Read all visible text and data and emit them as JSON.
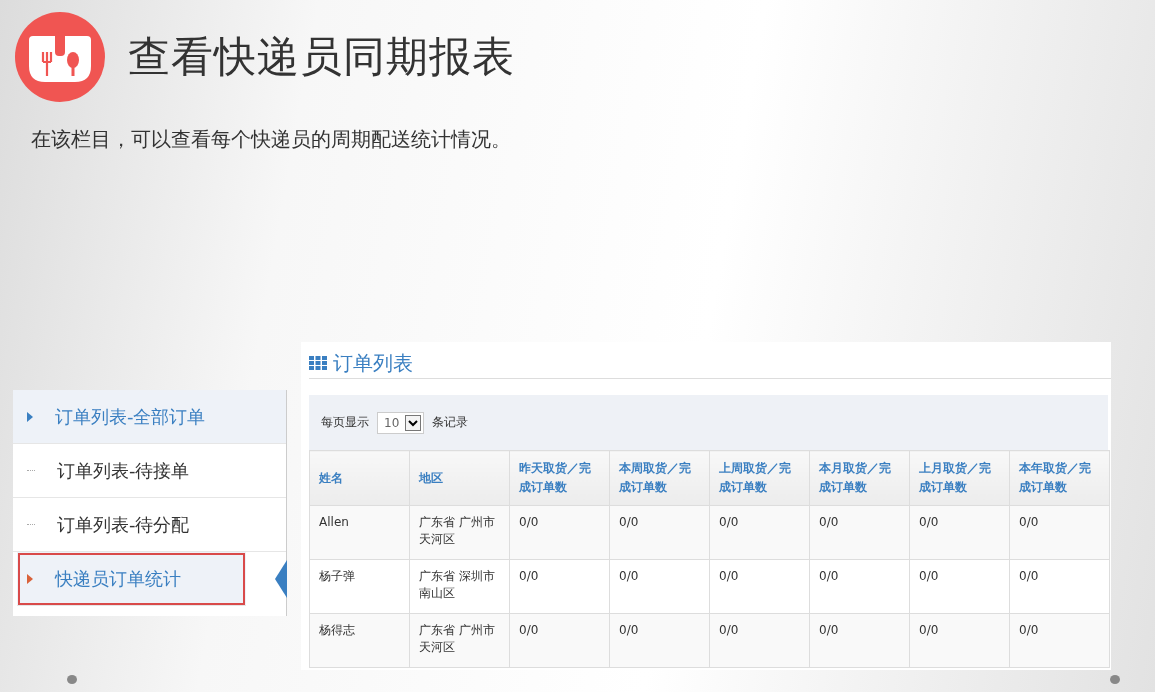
{
  "title": "查看快递员同期报表",
  "subtitle": "在该栏目，可以查看每个快递员的周期配送统计情况。",
  "sidebar": {
    "items": [
      {
        "label": "订单列表-全部订单",
        "kind": "parent",
        "selected": false
      },
      {
        "label": "订单列表-待接单",
        "kind": "child",
        "selected": false
      },
      {
        "label": "订单列表-待分配",
        "kind": "child",
        "selected": false
      },
      {
        "label": "快递员订单统计",
        "kind": "parent",
        "selected": true
      }
    ]
  },
  "panel": {
    "title": "订单列表",
    "page_size": {
      "before": "每页显示",
      "value": "10",
      "after": "条记录"
    },
    "table": {
      "columns": [
        "姓名",
        "地区",
        "昨天取货／完成订单数",
        "本周取货／完成订单数",
        "上周取货／完成订单数",
        "本月取货／完成订单数",
        "上月取货／完成订单数",
        "本年取货／完成订单数"
      ],
      "rows": [
        [
          "Allen",
          "广东省 广州市天河区",
          "0/0",
          "0/0",
          "0/0",
          "0/0",
          "0/0",
          "0/0"
        ],
        [
          "杨子弹",
          "广东省 深圳市南山区",
          "0/0",
          "0/0",
          "0/0",
          "0/0",
          "0/0",
          "0/0"
        ],
        [
          "杨得志",
          "广东省 广州市天河区",
          "0/0",
          "0/0",
          "0/0",
          "0/0",
          "0/0",
          "0/0"
        ]
      ]
    }
  }
}
